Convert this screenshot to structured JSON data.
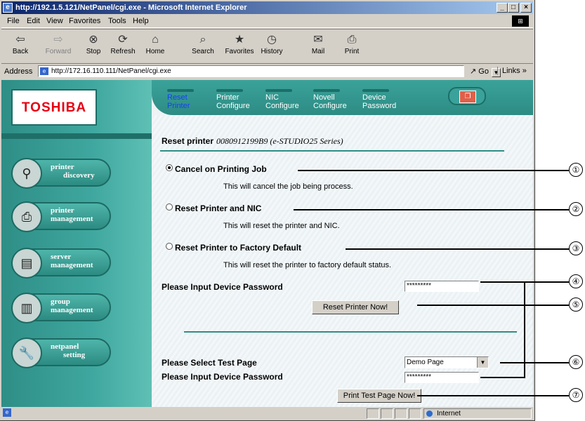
{
  "window": {
    "title": "http://192.1.5.121/NetPanel/cgi.exe - Microsoft Internet Explorer",
    "controls": [
      "_",
      "□",
      "×"
    ]
  },
  "menu": [
    "File",
    "Edit",
    "View",
    "Favorites",
    "Tools",
    "Help"
  ],
  "toolbar": {
    "back": "Back",
    "forward": "Forward",
    "stop": "Stop",
    "refresh": "Refresh",
    "home": "Home",
    "search": "Search",
    "favorites": "Favorites",
    "history": "History",
    "mail": "Mail",
    "print": "Print"
  },
  "address": {
    "label": "Address",
    "url": "http://172.16.110.111/NetPanel/cgi.exe",
    "go": "Go",
    "links": "Links »"
  },
  "brand": "TOSHIBA",
  "sidebar": {
    "items": [
      {
        "line1": "printer",
        "line2": "discovery"
      },
      {
        "line1": "printer",
        "line2": "management"
      },
      {
        "line1": "server",
        "line2": "management"
      },
      {
        "line1": "group",
        "line2": "management"
      },
      {
        "line1": "netpanel",
        "line2": "setting"
      }
    ]
  },
  "tabs": [
    {
      "line1": "Reset",
      "line2": "Printer",
      "active": true
    },
    {
      "line1": "Printer",
      "line2": "Configure"
    },
    {
      "line1": "NIC",
      "line2": "Configure"
    },
    {
      "line1": "Novell",
      "line2": "Configure"
    },
    {
      "line1": "Device",
      "line2": "Password"
    }
  ],
  "main": {
    "heading": "Reset printer",
    "device": "0080912199B9 (e-STUDIO25 Series)",
    "options": [
      {
        "label": "Cancel on Printing Job",
        "desc": "This will cancel the job being process.",
        "selected": true
      },
      {
        "label": "Reset Printer and NIC",
        "desc": "This will reset the printer and NIC.",
        "selected": false
      },
      {
        "label": "Reset Printer to Factory Default",
        "desc": "This will reset the printer to factory default status.",
        "selected": false
      }
    ],
    "password_label": "Please Input Device Password",
    "password_value": "*********",
    "reset_button": "Reset Printer Now!",
    "testpage_label": "Please Select Test Page",
    "testpage_value": "Demo Page",
    "password_label2": "Please Input Device Password",
    "password_value2": "*********",
    "print_button": "Print Test Page Now!"
  },
  "status": {
    "zone": "Internet"
  },
  "callouts": [
    "①",
    "②",
    "③",
    "④",
    "⑤",
    "⑥",
    "⑦"
  ]
}
